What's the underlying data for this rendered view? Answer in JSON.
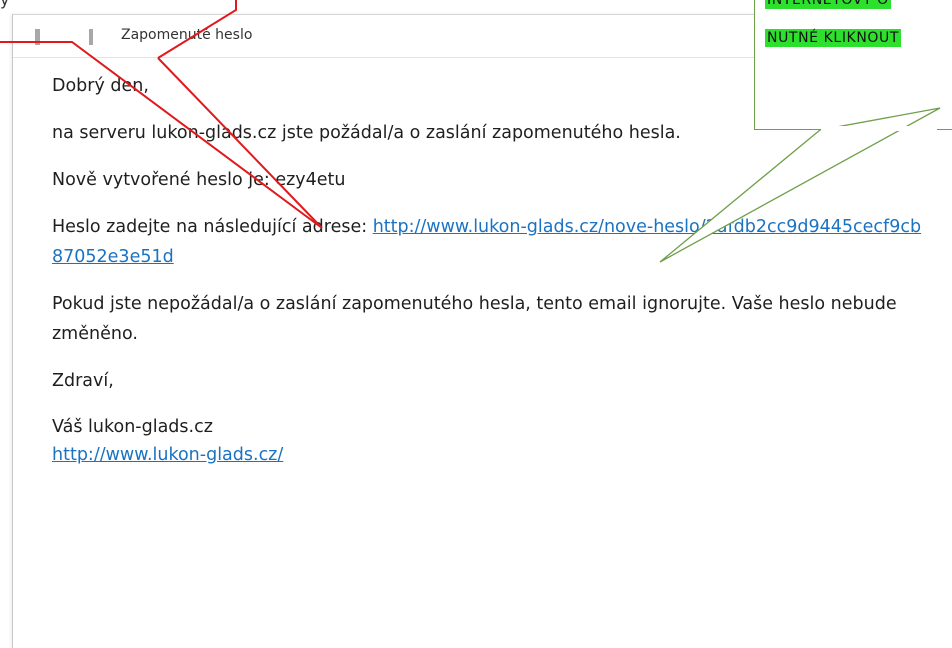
{
  "email": {
    "subject": "Zapomenuté heslo",
    "greeting": "Dobrý den,",
    "line_request": "na serveru lukon-glads.cz jste požádal/a o zaslání zapomenutého hesla.",
    "line_password_label": "Nově vytvořené heslo je: ",
    "password": "ezy4etu",
    "line_link_label": "Heslo zadejte na následující adrese: ",
    "reset_link": "http://www.lukon-glads.cz/nove-heslo/2afdb2cc9d9445cecf9cb87052e3e51d",
    "line_ignore": "Pokud jste nepožádal/a o zaslání zapomenutého hesla, tento email ignorujte. Vaše heslo nebude změněno.",
    "closing": "Zdraví,",
    "signature_name": "Váš lukon-glads.cz",
    "signature_link": "http://www.lukon-glads.cz/"
  },
  "annotation": {
    "callout_line1": "INTERNETOVÝ O",
    "callout_line2": "NUTNÉ KLIKNOUT",
    "top_left": "y"
  },
  "colors": {
    "link": "#1a73c2",
    "red_arrow": "#e0191c",
    "green_callout": "#6ea04a",
    "highlight": "#2ee02e"
  }
}
